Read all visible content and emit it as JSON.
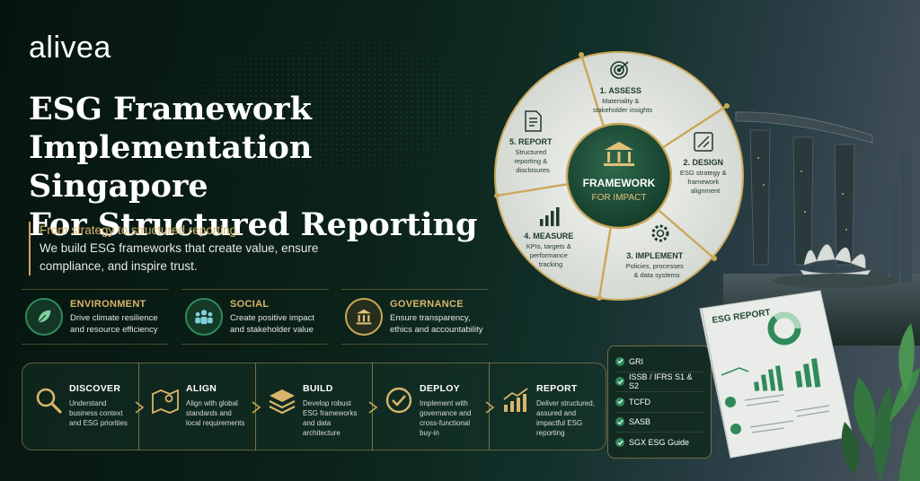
{
  "brand": {
    "logo": "alivea"
  },
  "hero": {
    "title_line1": "ESG Framework",
    "title_line2": "Implementation Singapore",
    "title_line3": "For Structured Reporting",
    "tagline_highlight": "From strategy to structured reporting.",
    "tagline_rest": "We build ESG frameworks that create value, ensure compliance, and inspire trust."
  },
  "pillars": [
    {
      "name": "ENVIRONMENT",
      "desc": "Drive climate resilience and resource efficiency",
      "icon": "leaf-icon"
    },
    {
      "name": "SOCIAL",
      "desc": "Create positive impact and stakeholder value",
      "icon": "people-icon"
    },
    {
      "name": "GOVERNANCE",
      "desc": "Ensure transparency, ethics and accountability",
      "icon": "institution-icon"
    }
  ],
  "wheel": {
    "center_title": "FRAMEWORK",
    "center_sub": "FOR IMPACT",
    "segments": [
      {
        "title": "1. ASSESS",
        "desc1": "Materiality &",
        "desc2": "stakeholder insights",
        "icon": "target-icon"
      },
      {
        "title": "2. DESIGN",
        "desc1": "ESG strategy &",
        "desc2": "framework",
        "desc3": "alignment",
        "icon": "design-icon"
      },
      {
        "title": "3. IMPLEMENT",
        "desc1": "Policies, processes",
        "desc2": "& data systems",
        "icon": "gear-icon"
      },
      {
        "title": "4. MEASURE",
        "desc1": "KPIs, targets &",
        "desc2": "performance",
        "desc3": "tracking",
        "icon": "bar-chart-icon"
      },
      {
        "title": "5. REPORT",
        "desc1": "Structured",
        "desc2": "reporting &",
        "desc3": "disclosures",
        "icon": "document-icon"
      }
    ]
  },
  "process": [
    {
      "name": "DISCOVER",
      "desc": "Understand business context and ESG priorities",
      "icon": "magnifier-icon"
    },
    {
      "name": "ALIGN",
      "desc": "Align with global standards and local requirements",
      "icon": "map-pin-icon"
    },
    {
      "name": "BUILD",
      "desc": "Develop robust ESG frameworks and data architecture",
      "icon": "layers-icon"
    },
    {
      "name": "DEPLOY",
      "desc": "Implement with governance and cross-functional buy-in",
      "icon": "check-circle-icon"
    },
    {
      "name": "REPORT",
      "desc": "Deliver structured, assured and impactful ESG reporting",
      "icon": "growth-chart-icon"
    }
  ],
  "standards": [
    "GRI",
    "ISSB / IFRS S1 & S2",
    "TCFD",
    "SASB",
    "SGX ESG Guide"
  ],
  "report_booklet": {
    "title": "ESG REPORT"
  },
  "colors": {
    "accent_gold": "#c9a85a",
    "accent_green": "#2f8a5b",
    "bg_dark": "#0b2219"
  }
}
